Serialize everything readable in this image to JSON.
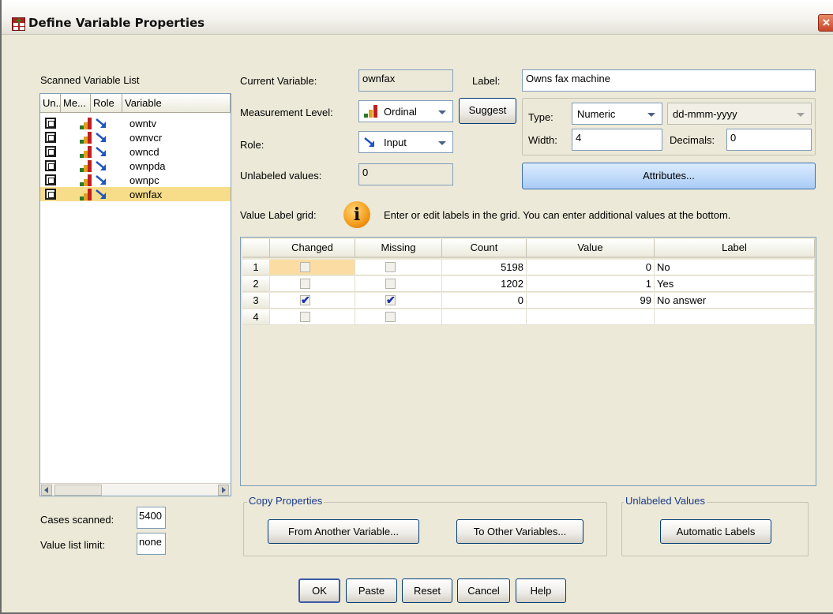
{
  "window": {
    "title": "Define Variable Properties"
  },
  "scanned": {
    "title": "Scanned Variable List",
    "columns": [
      "Un...",
      "Me...",
      "Role",
      "Variable"
    ],
    "rows": [
      {
        "variable": "owntv",
        "selected": false
      },
      {
        "variable": "ownvcr",
        "selected": false
      },
      {
        "variable": "owncd",
        "selected": false
      },
      {
        "variable": "ownpda",
        "selected": false
      },
      {
        "variable": "ownpc",
        "selected": false
      },
      {
        "variable": "ownfax",
        "selected": true
      }
    ],
    "cases_scanned_label": "Cases scanned:",
    "cases_scanned_value": "5400",
    "value_list_limit_label": "Value list limit:",
    "value_list_limit_value": "none"
  },
  "properties": {
    "current_variable_label": "Current Variable:",
    "current_variable_value": "ownfax",
    "label_label": "Label:",
    "label_value": "Owns fax machine",
    "measurement_label": "Measurement Level:",
    "measurement_value": "Ordinal",
    "suggest_button": "Suggest",
    "type_label": "Type:",
    "type_value": "Numeric",
    "format_value": "dd-mmm-yyyy",
    "role_label": "Role:",
    "role_value": "Input",
    "width_label": "Width:",
    "width_value": "4",
    "decimals_label": "Decimals:",
    "decimals_value": "0",
    "unlabeled_label": "Unlabeled values:",
    "unlabeled_value": "0",
    "attributes_button": "Attributes...",
    "value_label_grid_label": "Value Label grid:",
    "info_icon_glyph": "i",
    "grid_hint": "Enter or edit labels in the grid. You can enter additional values at the bottom."
  },
  "grid": {
    "columns": [
      "Changed",
      "Missing",
      "Count",
      "Value",
      "Label"
    ],
    "rows": [
      {
        "num": "1",
        "changed": false,
        "missing": false,
        "count": "5198",
        "value": "0",
        "label": "No"
      },
      {
        "num": "2",
        "changed": false,
        "missing": false,
        "count": "1202",
        "value": "1",
        "label": "Yes"
      },
      {
        "num": "3",
        "changed": true,
        "missing": true,
        "count": "0",
        "value": "99",
        "label": "No answer"
      },
      {
        "num": "4",
        "changed": false,
        "missing": false,
        "count": "",
        "value": "",
        "label": ""
      }
    ]
  },
  "copy_properties": {
    "title": "Copy Properties",
    "from_button": "From Another Variable...",
    "to_button": "To Other Variables..."
  },
  "unlabeled_values": {
    "title": "Unlabeled Values",
    "auto_button": "Automatic Labels"
  },
  "buttons": {
    "ok": "OK",
    "paste": "Paste",
    "reset": "Reset",
    "cancel": "Cancel",
    "help": "Help"
  },
  "colors": {
    "dialog_bg": "#ece9d8",
    "selection": "#f7dc8a",
    "accent_border": "#7f9db9",
    "check": "#1c2fa8"
  }
}
